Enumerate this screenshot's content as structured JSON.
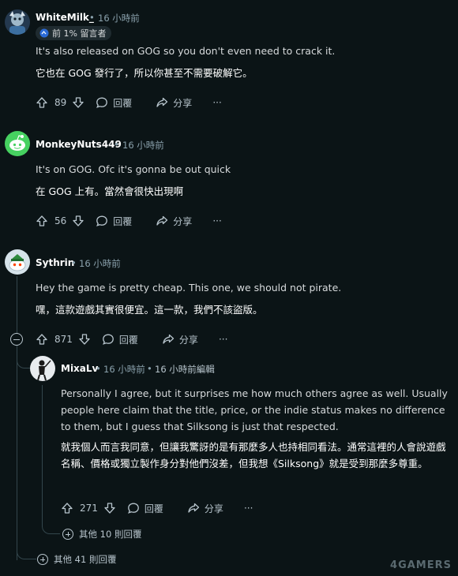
{
  "comments": [
    {
      "username": "WhiteMilk_",
      "time": "16 小時前",
      "badge": "前 1% 留言者",
      "text_en": "It's also released on GOG so you don't even need to crack it.",
      "text_zh": "它也在 GOG 發行了，所以你甚至不需要破解它。",
      "votes": "89",
      "reply_label": "回覆",
      "share_label": "分享",
      "more_label": "···"
    },
    {
      "username": "MonkeyNuts449",
      "time": "16 小時前",
      "text_en": "It's on GOG. Ofc it's gonna be out quick",
      "text_zh": "在 GOG 上有。當然會很快出現啊",
      "votes": "56",
      "reply_label": "回覆",
      "share_label": "分享",
      "more_label": "···"
    },
    {
      "username": "Sythrin",
      "time": "16 小時前",
      "text_en": "Hey the game is pretty cheap. This one, we should not pirate.",
      "text_zh": "嘿，這款遊戲其實很便宜。這一款，我們不該盜版。",
      "votes": "871",
      "reply_label": "回覆",
      "share_label": "分享",
      "more_label": "···"
    },
    {
      "username": "MixaLv",
      "time": "16 小時前",
      "edited": "16 小時前編輯",
      "text_en": "Personally I agree, but it surprises me how much others agree as well. Usually people here claim that the title, price, or the indie status makes no difference to them, but I guess that Silksong is just that respected.",
      "text_zh": "就我個人而言我同意，但讓我驚訝的是有那麼多人也持相同看法。通常這裡的人會說遊戲名稱、價格或獨立製作身分對他們沒差，但我想《Silksong》就是受到那麼多尊重。",
      "votes": "271",
      "reply_label": "回覆",
      "share_label": "分享",
      "more_label": "···"
    }
  ],
  "more_replies_nested": "其他 10 則回覆",
  "more_replies_root": "其他 41 則回覆",
  "separator": "•",
  "watermark": "4GAMERS",
  "colors": {
    "background": "#0b1416",
    "text": "#d7dadc",
    "meta": "#8ba2ad",
    "thread_line": "#33464c"
  },
  "icons": {
    "upvote": "arrow-up-icon",
    "downvote": "arrow-down-icon",
    "reply": "speech-bubble-icon",
    "share": "share-arrow-icon",
    "more": "ellipsis-icon",
    "badge": "top-commenter-icon",
    "expand": "plus-circle-icon",
    "collapse": "minus-circle-icon"
  }
}
